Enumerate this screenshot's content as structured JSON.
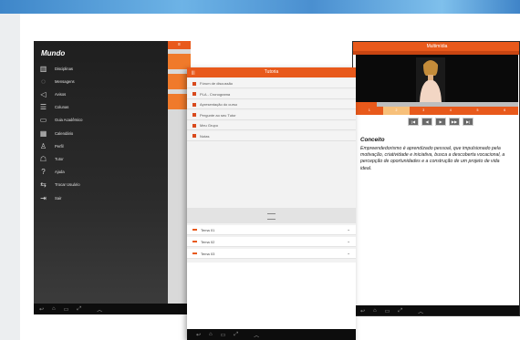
{
  "tablet_left": {
    "logo": "Mundo",
    "menu": [
      {
        "label": "Disciplinas",
        "icon": "books-icon"
      },
      {
        "label": "Mensagens",
        "icon": "chat-icon"
      },
      {
        "label": "Avisos",
        "icon": "megaphone-icon"
      },
      {
        "label": "Colunas",
        "icon": "columns-icon"
      },
      {
        "label": "Guia Acadêmico",
        "icon": "book-icon"
      },
      {
        "label": "Calendário",
        "icon": "calendar-icon"
      },
      {
        "label": "Perfil",
        "icon": "person-icon"
      },
      {
        "label": "Tutor",
        "icon": "tutor-icon"
      },
      {
        "label": "Ajuda",
        "icon": "help-icon"
      },
      {
        "label": "Trocar Usuário",
        "icon": "switch-user-icon"
      },
      {
        "label": "Sair",
        "icon": "logout-icon"
      }
    ]
  },
  "tablet_middle": {
    "header_title": "Tutoria",
    "back_label": "|||",
    "rows": [
      "Fórum de discussão",
      "PLA - Cronograma",
      "Apresentação do curso",
      "Pergunte ao seu Tutor",
      "Meu Grupo",
      "Notas"
    ],
    "topics": [
      "Tema 01",
      "Tema 02",
      "Tema 03"
    ]
  },
  "tablet_right": {
    "header_title": "Multimídia",
    "slide_labels": [
      "1",
      "2",
      "3",
      "4",
      "5",
      "6"
    ],
    "active_slide": 2,
    "progress_fraction": 0.13,
    "controls": [
      "|◀",
      "◀",
      "▶",
      "▶▶",
      "▶|"
    ],
    "content_title": "Conceito",
    "content_body": "Empreendedorismo é aprendizado pessoal, que impulsionado pela motivação, criatividade e iniciativa, busca a descoberta vocacional, a percepção de oportunidades e a construção de um projeto de vida ideal."
  },
  "nav_bar": {
    "back": "↩",
    "home": "⌂",
    "recent": "▭",
    "expand": "⤢",
    "up": "︿"
  },
  "colors": {
    "accent": "#e8591b",
    "dark_menu": "#1f1f1f"
  }
}
